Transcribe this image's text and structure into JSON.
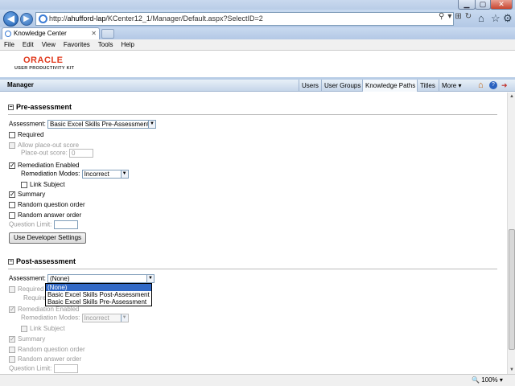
{
  "browser": {
    "url_prefix": "http://",
    "url_host": "ahufford-lap",
    "url_path": "/KCenter12_1/Manager/Default.aspx?SelectID=2",
    "tab_title": "Knowledge Center",
    "menu": [
      "File",
      "Edit",
      "View",
      "Favorites",
      "Tools",
      "Help"
    ],
    "zoom": "100%"
  },
  "brand": {
    "logo": "ORACLE",
    "product": "USER PRODUCTIVITY KIT"
  },
  "manager": {
    "title": "Manager",
    "nav": [
      "Users",
      "User Groups",
      "Knowledge Paths",
      "Titles",
      "More"
    ]
  },
  "pre": {
    "heading": "Pre-assessment",
    "toggle": "⊟",
    "assessment_label": "Assessment:",
    "assessment_value": "Basic Excel Skills Pre-Assessment",
    "required": "Required",
    "allow_place_out": "Allow place-out score",
    "place_out_label": "Place-out score:",
    "place_out_value": "0",
    "remediation_enabled": "Remediation Enabled",
    "remediation_modes_label": "Remediation Modes:",
    "remediation_modes_value": "Incorrect",
    "link_subject": "Link Subject",
    "summary": "Summary",
    "random_question": "Random question order",
    "random_answer": "Random answer order",
    "question_limit": "Question Limit:",
    "dev_button": "Use Developer Settings"
  },
  "post": {
    "heading": "Post-assessment",
    "toggle": "⊟",
    "assessment_label": "Assessment:",
    "assessment_value": "(None)",
    "options": [
      "(None)",
      "Basic Excel Skills Post-Assessment",
      "Basic Excel Skills Pre-Assessment"
    ],
    "required": "Required",
    "required_trunc": "Required",
    "remediation_enabled": "Remediation Enabled",
    "remediation_modes_label": "Remediation Modes:",
    "remediation_modes_value": "Incorrect",
    "link_subject": "Link Subject",
    "summary": "Summary",
    "random_question": "Random question order",
    "random_answer": "Random answer order",
    "question_limit": "Question Limit:"
  }
}
